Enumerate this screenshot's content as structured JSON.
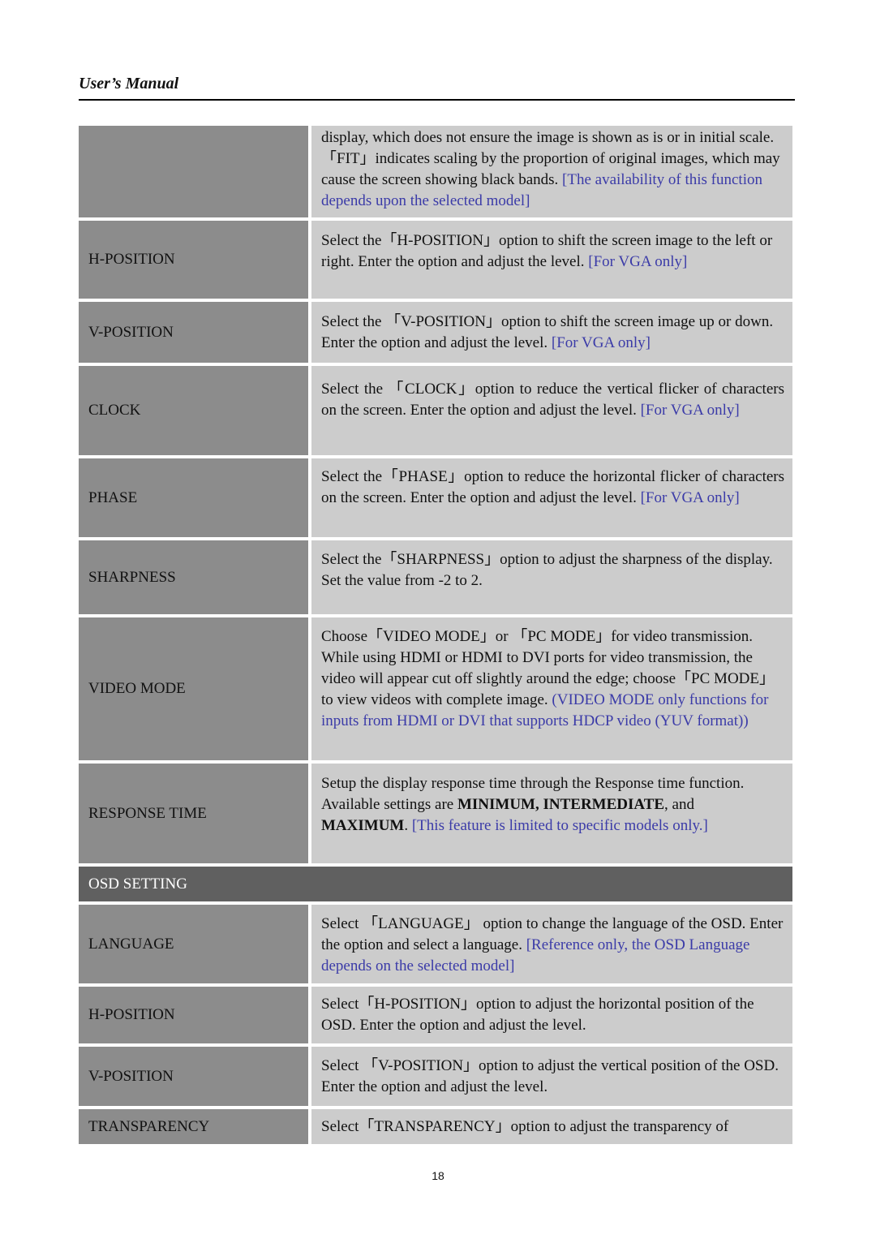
{
  "header": {
    "title": "User’s Manual"
  },
  "rows": [
    {
      "label": "",
      "text": "display, which does not ensure the image is shown as is or in initial scale. 「FIT」indicates scaling by the proportion of original images, which may cause the screen showing black bands. ",
      "note": "[The availability of this function depends upon the selected model]"
    },
    {
      "label": "H-POSITION",
      "text": "Select the「H-POSITION」option to shift the screen image to the left or right. Enter the option and adjust the level. ",
      "note": "[For VGA only]"
    },
    {
      "label": "V-POSITION",
      "text": "Select the 「V-POSITION」option to shift the screen image up or down. Enter the option and adjust the level. ",
      "note": "[For VGA only]"
    },
    {
      "label": "CLOCK",
      "text": "Select the 「CLOCK」option to reduce the vertical flicker of characters on the screen. Enter the option and adjust the level. ",
      "note": "[For VGA only]"
    },
    {
      "label": "PHASE",
      "text": "Select the「PHASE」option to reduce the horizontal flicker of characters on the screen. Enter the option and adjust the level. ",
      "note": "[For VGA only]"
    },
    {
      "label": "SHARPNESS",
      "text": "Select the「SHARPNESS」option to adjust the sharpness of the display. Set the value from -2 to 2.",
      "note": ""
    },
    {
      "label": "VIDEO MODE",
      "text": "Choose「VIDEO MODE」or 「PC MODE」for video transmission. While using HDMI or HDMI to DVI ports for video transmission, the video will appear cut off slightly around the edge; choose「PC MODE」to view videos with complete image. ",
      "note": "(VIDEO MODE only functions for inputs from HDMI or DVI that supports HDCP video (YUV format))"
    },
    {
      "label": "RESPONSE TIME",
      "text_a": "Setup the display response time through the Response time function. Available settings are ",
      "bold_a": "MINIMUM, INTERMEDIATE",
      "text_b": ", and ",
      "bold_b": "MAXIMUM",
      "text_c": ". ",
      "note": "[This feature is limited to specific models only.]"
    }
  ],
  "section": {
    "title": "OSD SETTING"
  },
  "osd_rows": [
    {
      "label": "LANGUAGE",
      "text": "Select 「LANGUAGE」 option to change the language of the OSD. Enter the option and select a language. ",
      "note": "[Reference only, the OSD Language depends on the selected model]"
    },
    {
      "label": "H-POSITION",
      "text": "Select「H-POSITION」option to adjust the horizontal position of the OSD. Enter the option and adjust the level.",
      "note": ""
    },
    {
      "label": "V-POSITION",
      "text": "Select 「V-POSITION」option to adjust the vertical position of the OSD. Enter the option and adjust the level.",
      "note": ""
    },
    {
      "label": "TRANSPARENCY",
      "text": "Select「TRANSPARENCY」option to adjust the transparency of",
      "note": ""
    }
  ],
  "footer": {
    "page_number": "18"
  }
}
